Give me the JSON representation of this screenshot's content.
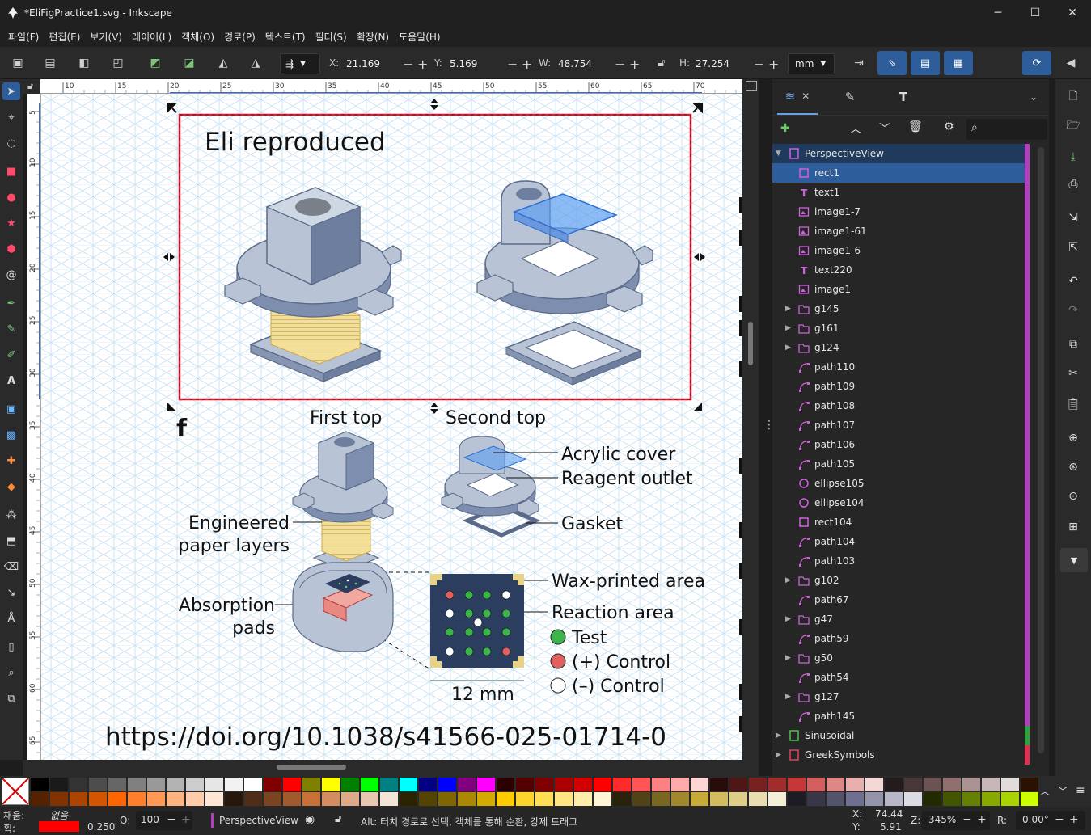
{
  "window": {
    "title": "*EliFigPractice1.svg - Inkscape",
    "min": "─",
    "max": "☐",
    "close": "✕"
  },
  "menu": [
    "파일(F)",
    "편집(E)",
    "보기(V)",
    "레이어(L)",
    "객체(O)",
    "경로(P)",
    "텍스트(T)",
    "필터(S)",
    "확장(N)",
    "도움말(H)"
  ],
  "toolctrl": {
    "x_label": "X:",
    "x": "21.169",
    "y_label": "Y:",
    "y": "5.169",
    "w_label": "W:",
    "w": "48.754",
    "h_label": "H:",
    "h": "27.254",
    "unit": "mm"
  },
  "ruler_top": [
    "10",
    "15",
    "20",
    "25",
    "30",
    "35",
    "40",
    "45",
    "50",
    "55",
    "60",
    "65",
    "70"
  ],
  "ruler_left": [
    "5",
    "10",
    "15",
    "20",
    "25",
    "30",
    "35",
    "40",
    "45",
    "50",
    "55",
    "60",
    "65"
  ],
  "canvas": {
    "title": "Eli reproduced",
    "panel_letter": "f",
    "first_top": "First top",
    "second_top": "Second top",
    "acrylic": "Acrylic cover",
    "reagent": "Reagent outlet",
    "gasket": "Gasket",
    "engineered1": "Engineered",
    "engineered2": "paper layers",
    "wax": "Wax-printed area",
    "reaction": "Reaction area",
    "absorb1": "Absorption",
    "absorb2": "pads",
    "test": "Test",
    "pos": "(+) Control",
    "neg": "(–) Control",
    "mm": "12 mm",
    "doi": "https://doi.org/10.1038/s41566-025-01714-0",
    "colors": {
      "accent_red": "#e8182d",
      "test_green": "#3cb44b",
      "pos_red": "#e06060",
      "grid": "#b9daf0",
      "part": "#b8c4d6",
      "pad": "#f0d98a"
    }
  },
  "panel": {
    "tabs": [
      "layers-icon",
      "fill-stroke-icon",
      "text-icon"
    ],
    "tab_close": "✕",
    "layers": [
      {
        "name": "PerspectiveView",
        "type": "layer",
        "depth": 0,
        "expanded": true,
        "selected": false,
        "stripe": "#b040c0"
      },
      {
        "name": "rect1",
        "type": "rect",
        "depth": 1,
        "selected": true,
        "stripe": "#b040c0"
      },
      {
        "name": "text1",
        "type": "text",
        "depth": 1,
        "stripe": "#b040c0"
      },
      {
        "name": "image1-7",
        "type": "image",
        "depth": 1,
        "stripe": "#b040c0"
      },
      {
        "name": "image1-61",
        "type": "image",
        "depth": 1,
        "stripe": "#b040c0"
      },
      {
        "name": "image1-6",
        "type": "image",
        "depth": 1,
        "stripe": "#b040c0"
      },
      {
        "name": "text220",
        "type": "text",
        "depth": 1,
        "stripe": "#b040c0"
      },
      {
        "name": "image1",
        "type": "image",
        "depth": 1,
        "stripe": "#b040c0"
      },
      {
        "name": "g145",
        "type": "group",
        "depth": 1,
        "collapsed": true,
        "stripe": "#b040c0"
      },
      {
        "name": "g161",
        "type": "group",
        "depth": 1,
        "collapsed": true,
        "stripe": "#b040c0"
      },
      {
        "name": "g124",
        "type": "group",
        "depth": 1,
        "collapsed": true,
        "stripe": "#b040c0"
      },
      {
        "name": "path110",
        "type": "path",
        "depth": 1,
        "stripe": "#b040c0"
      },
      {
        "name": "path109",
        "type": "path",
        "depth": 1,
        "stripe": "#b040c0"
      },
      {
        "name": "path108",
        "type": "path",
        "depth": 1,
        "stripe": "#b040c0"
      },
      {
        "name": "path107",
        "type": "path",
        "depth": 1,
        "stripe": "#b040c0"
      },
      {
        "name": "path106",
        "type": "path",
        "depth": 1,
        "stripe": "#b040c0"
      },
      {
        "name": "path105",
        "type": "path",
        "depth": 1,
        "stripe": "#b040c0"
      },
      {
        "name": "ellipse105",
        "type": "ellipse",
        "depth": 1,
        "stripe": "#b040c0"
      },
      {
        "name": "ellipse104",
        "type": "ellipse",
        "depth": 1,
        "stripe": "#b040c0"
      },
      {
        "name": "rect104",
        "type": "rect",
        "depth": 1,
        "stripe": "#b040c0"
      },
      {
        "name": "path104",
        "type": "path",
        "depth": 1,
        "stripe": "#b040c0"
      },
      {
        "name": "path103",
        "type": "path",
        "depth": 1,
        "stripe": "#b040c0"
      },
      {
        "name": "g102",
        "type": "group",
        "depth": 1,
        "collapsed": true,
        "stripe": "#b040c0"
      },
      {
        "name": "path67",
        "type": "path",
        "depth": 1,
        "stripe": "#b040c0"
      },
      {
        "name": "g47",
        "type": "group",
        "depth": 1,
        "collapsed": true,
        "stripe": "#b040c0"
      },
      {
        "name": "path59",
        "type": "path",
        "depth": 1,
        "stripe": "#b040c0"
      },
      {
        "name": "g50",
        "type": "group",
        "depth": 1,
        "collapsed": true,
        "stripe": "#b040c0"
      },
      {
        "name": "path54",
        "type": "path",
        "depth": 1,
        "stripe": "#b040c0"
      },
      {
        "name": "g127",
        "type": "group",
        "depth": 1,
        "collapsed": true,
        "stripe": "#b040c0"
      },
      {
        "name": "path145",
        "type": "path",
        "depth": 1,
        "stripe": "#b040c0"
      },
      {
        "name": "Sinusoidal",
        "type": "layer-green",
        "depth": 0,
        "collapsed": true,
        "stripe": "#30a040"
      },
      {
        "name": "GreekSymbols",
        "type": "layer-red",
        "depth": 0,
        "collapsed": true,
        "stripe": "#e03050"
      }
    ]
  },
  "palette": [
    "#000000",
    "#1a1a1a",
    "#333333",
    "#4d4d4d",
    "#666666",
    "#808080",
    "#999999",
    "#b3b3b3",
    "#cccccc",
    "#e6e6e6",
    "#f2f2f2",
    "#ffffff",
    "#800000",
    "#ff0000",
    "#808000",
    "#ffff00",
    "#008000",
    "#00ff00",
    "#008080",
    "#00ffff",
    "#000080",
    "#0000ff",
    "#800080",
    "#ff00ff",
    "#2b0000",
    "#550000",
    "#800000",
    "#aa0000",
    "#d40000",
    "#ff0000",
    "#ff2a2a",
    "#ff5555",
    "#ff8080",
    "#ffaaaa",
    "#ffd5d5",
    "#280b0b",
    "#501616",
    "#782121",
    "#a02c2c",
    "#c83737",
    "#d35f5f",
    "#de8787",
    "#e9afaf",
    "#f4d7d7",
    "#241c1c",
    "#483737",
    "#6c5353",
    "#916f6f",
    "#ac9393",
    "#c8b7b7",
    "#e3dbdb",
    "#2b1100"
  ],
  "palette2": [
    "#552200",
    "#803300",
    "#aa4400",
    "#d45500",
    "#ff6600",
    "#ff7f2a",
    "#ff9955",
    "#ffb380",
    "#ffccaa",
    "#ffe6d5",
    "#28170b",
    "#502d16",
    "#784421",
    "#a05a2c",
    "#c87137",
    "#d38d5f",
    "#deaa87",
    "#e9c6af",
    "#f4e3d7",
    "#2b2200",
    "#554400",
    "#806600",
    "#aa8800",
    "#d4aa00",
    "#ffcc00",
    "#ffd42a",
    "#ffdd55",
    "#ffe680",
    "#ffeeaa",
    "#fff6d5",
    "#28220b",
    "#504416",
    "#786721",
    "#a0892c",
    "#c8ab37",
    "#d3bc5f",
    "#decd87",
    "#e9ddaf",
    "#f4eed7",
    "#1c1c24",
    "#373748",
    "#53536c",
    "#6f6f91",
    "#9393ac",
    "#b7b7c8",
    "#dbdbe3",
    "#222b00",
    "#445500",
    "#668000",
    "#88aa00",
    "#aad400",
    "#ccff00"
  ],
  "status": {
    "fill_label": "채움:",
    "fill_value": "없음",
    "stroke_label": "획:",
    "stroke_color": "#ff0000",
    "stroke_width": "0.250",
    "opacity_label": "O:",
    "opacity": "100",
    "layer": "PerspectiveView",
    "message": "Alt: 터치 경로로 선택, 객체를 통해 순환, 강제 드래그",
    "cx_label": "X:",
    "cx": "74.44",
    "cy_label": "Y:",
    "cy": "5.91",
    "zoom_label": "Z:",
    "zoom": "345%",
    "rot_label": "R:",
    "rot": "0.00°"
  }
}
